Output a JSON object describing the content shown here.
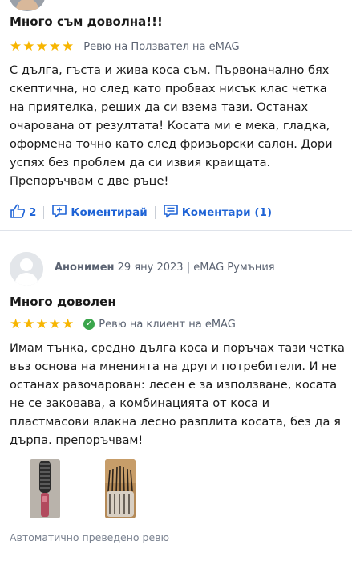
{
  "reviews": [
    {
      "title": "Много съм доволна!!!",
      "rating": 5,
      "review_type": "Ревю на Ползвател на eMAG",
      "body": "С дълга, гъста и жива коса съм. Първоначално бях скептична, но след като пробвах нисък клас четка на приятелка, реших да си взема тази. Останах очарована от резултата! Косата ми е мека, гладка, оформена точно като след фризьорски салон. Дори успях без проблем да си извия краищата. Препоръчвам с две ръце!",
      "likes": "2",
      "comment_label": "Коментирай",
      "comments_label": "Коментари (1)"
    },
    {
      "author": "Анонимен",
      "date": "29 яну 2023",
      "meta_sep": "|",
      "source": "eMAG Румъния",
      "title": "Много доволен",
      "rating": 5,
      "review_type": "Ревю на клиент на eMAG",
      "body": "Имам тънка, средно дълга коса и поръчах тази четка въз основа на мненията на други потребители. И не останах разочарован: лесен е за използване, косата не се заковава, а комбинацията от коса и пластмасови влакна лесно разплита косата, без да я дърпа. препоръчвам!",
      "footer_note": "Автоматично преведено ревю"
    }
  ],
  "colors": {
    "star": "#f7b500",
    "link": "#1e63d6",
    "verified": "#3aa54b",
    "muted": "#5b6372"
  },
  "icons": {
    "like": "thumbs-up-icon",
    "comment": "comment-plus-icon",
    "comments": "comments-list-icon",
    "verified": "check-circle-icon",
    "star": "star-icon",
    "avatar": "user-avatar-icon"
  }
}
